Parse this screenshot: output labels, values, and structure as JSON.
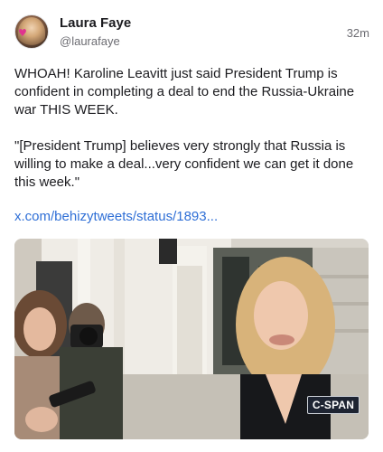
{
  "post": {
    "author": {
      "display_name": "Laura Faye",
      "handle": "@laurafaye",
      "avatar": "avatar"
    },
    "timestamp": "32m",
    "text": {
      "paragraph1": "WHOAH! Karoline Leavitt just said President Trump is confident in completing a deal to end the Russia-Ukraine war THIS WEEK.",
      "paragraph2": "\"[President Trump] believes very strongly that Russia is willing to make a deal...very confident we can get it done this week.\""
    },
    "link": "x.com/behizytweets/status/1893...",
    "media": {
      "broadcast_logo": "C-SPAN"
    }
  },
  "colors": {
    "link": "#2f6fd6",
    "secondary_text": "#6c6c72",
    "cspan_bg": "#1e2432"
  }
}
